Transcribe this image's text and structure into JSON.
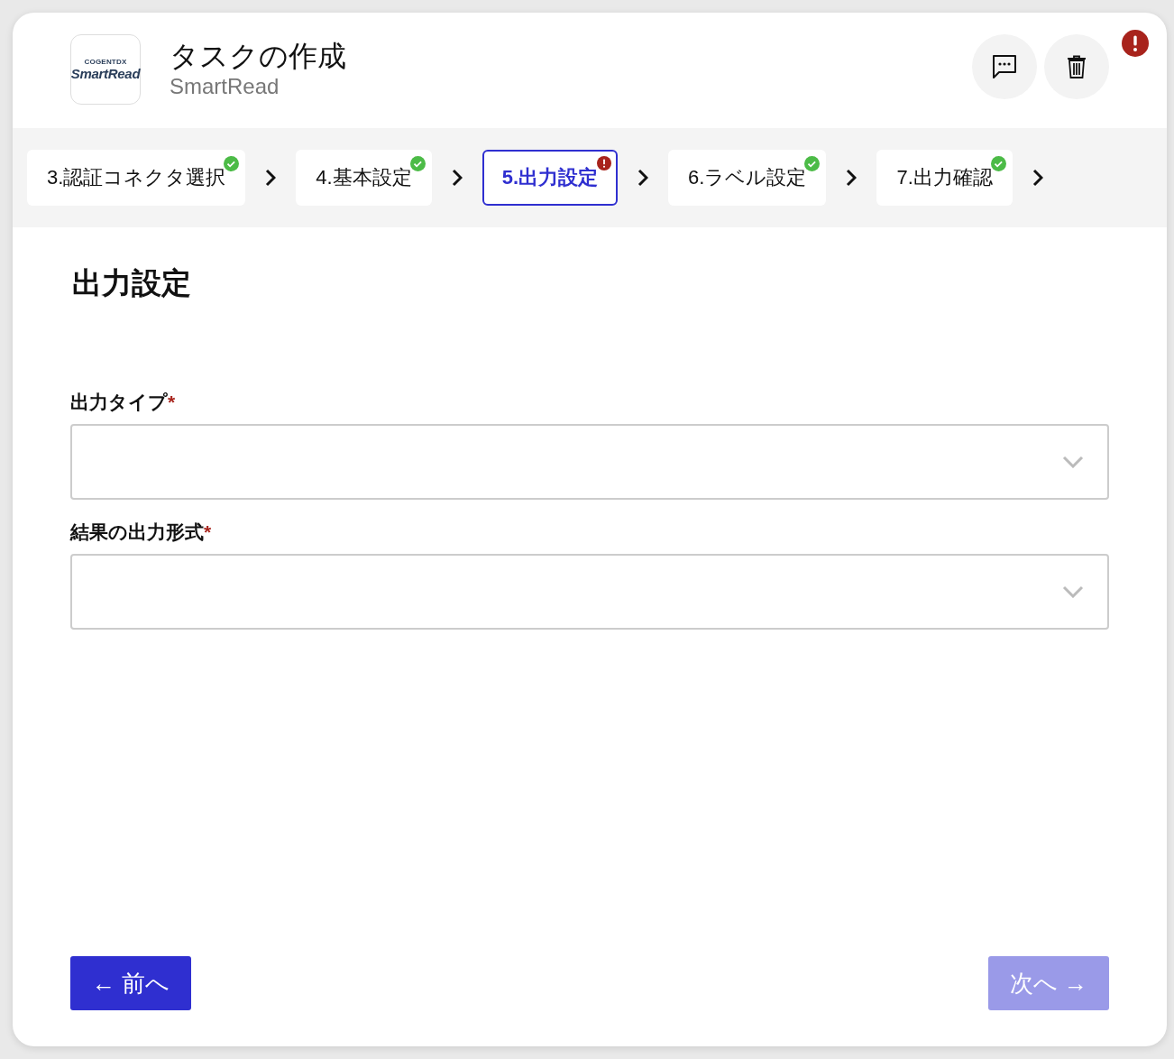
{
  "header": {
    "logo": {
      "brand_small": "COGENTDX",
      "brand": "SmartRead"
    },
    "title": "タスクの作成",
    "subtitle": "SmartRead",
    "has_error": true
  },
  "steps": [
    {
      "label": "3.認証コネクタ選択",
      "kind": "done",
      "selected": false
    },
    {
      "label": "4.基本設定",
      "kind": "done",
      "selected": false
    },
    {
      "label": "5.出力設定",
      "kind": "error",
      "selected": true
    },
    {
      "label": "6.ラベル設定",
      "kind": "done",
      "selected": false
    },
    {
      "label": "7.出力確認",
      "kind": "done",
      "selected": false
    }
  ],
  "section_title": "出力設定",
  "fields": [
    {
      "label": "出力タイプ",
      "required_mark": "*"
    },
    {
      "label": "結果の出力形式",
      "required_mark": "*"
    }
  ],
  "buttons": [
    {
      "label": "← 前へ",
      "disabled": false
    },
    {
      "label": "次へ →",
      "disabled": true
    }
  ]
}
